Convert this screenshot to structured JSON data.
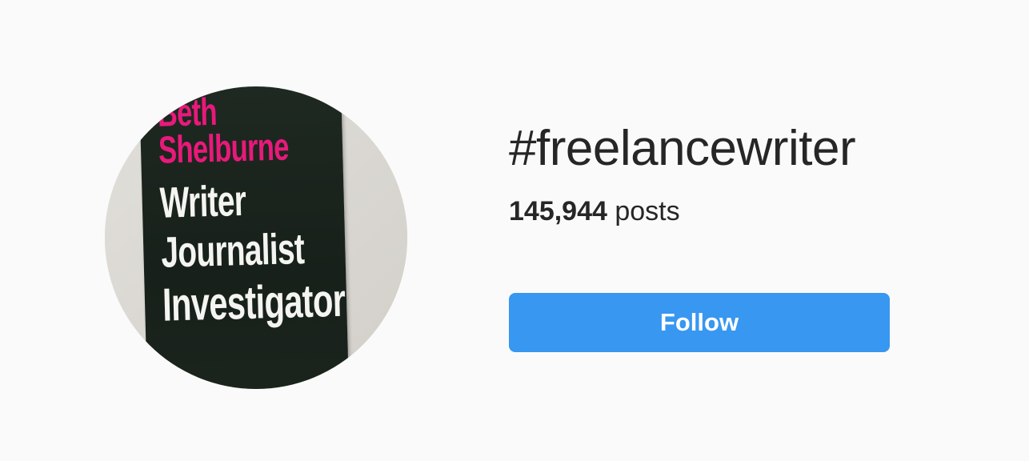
{
  "avatar": {
    "card_lines": [
      "Beth",
      "Shelburne",
      "Writer",
      "Journalist",
      "Investigator"
    ],
    "name_color": "#e8197a",
    "role_color": "#f4f4f1",
    "card_color": "#1b241d"
  },
  "hashtag": {
    "title": "#freelancewriter",
    "post_count": "145,944",
    "posts_label": "posts"
  },
  "follow_button": {
    "label": "Follow",
    "color": "#3897f0"
  }
}
